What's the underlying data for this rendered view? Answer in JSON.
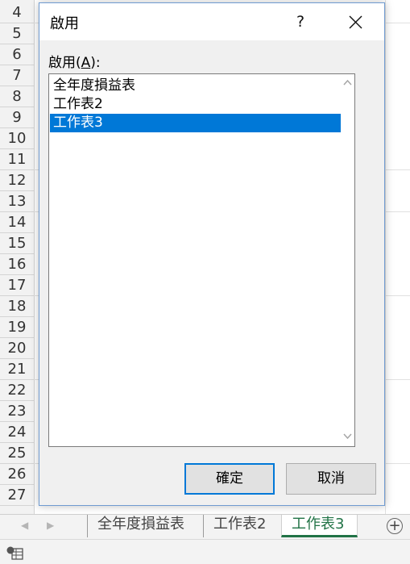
{
  "sheet": {
    "row_numbers": [
      "4",
      "5",
      "6",
      "7",
      "8",
      "9",
      "10",
      "11",
      "12",
      "13",
      "14",
      "15",
      "16",
      "17",
      "18",
      "19",
      "20",
      "21",
      "22",
      "23",
      "24",
      "25",
      "26",
      "27"
    ],
    "tabs": [
      "全年度損益表",
      "工作表2",
      "工作表3"
    ],
    "active_tab": "工作表3"
  },
  "dialog": {
    "title": "啟用",
    "help_label": "?",
    "list_label_prefix": "啟用(",
    "list_label_mnemonic": "A",
    "list_label_suffix": "):",
    "items": [
      "全年度損益表",
      "工作表2",
      "工作表3"
    ],
    "selected_item": "工作表3",
    "ok_label": "確定",
    "cancel_label": "取消",
    "accent_color": "#0078d7"
  }
}
